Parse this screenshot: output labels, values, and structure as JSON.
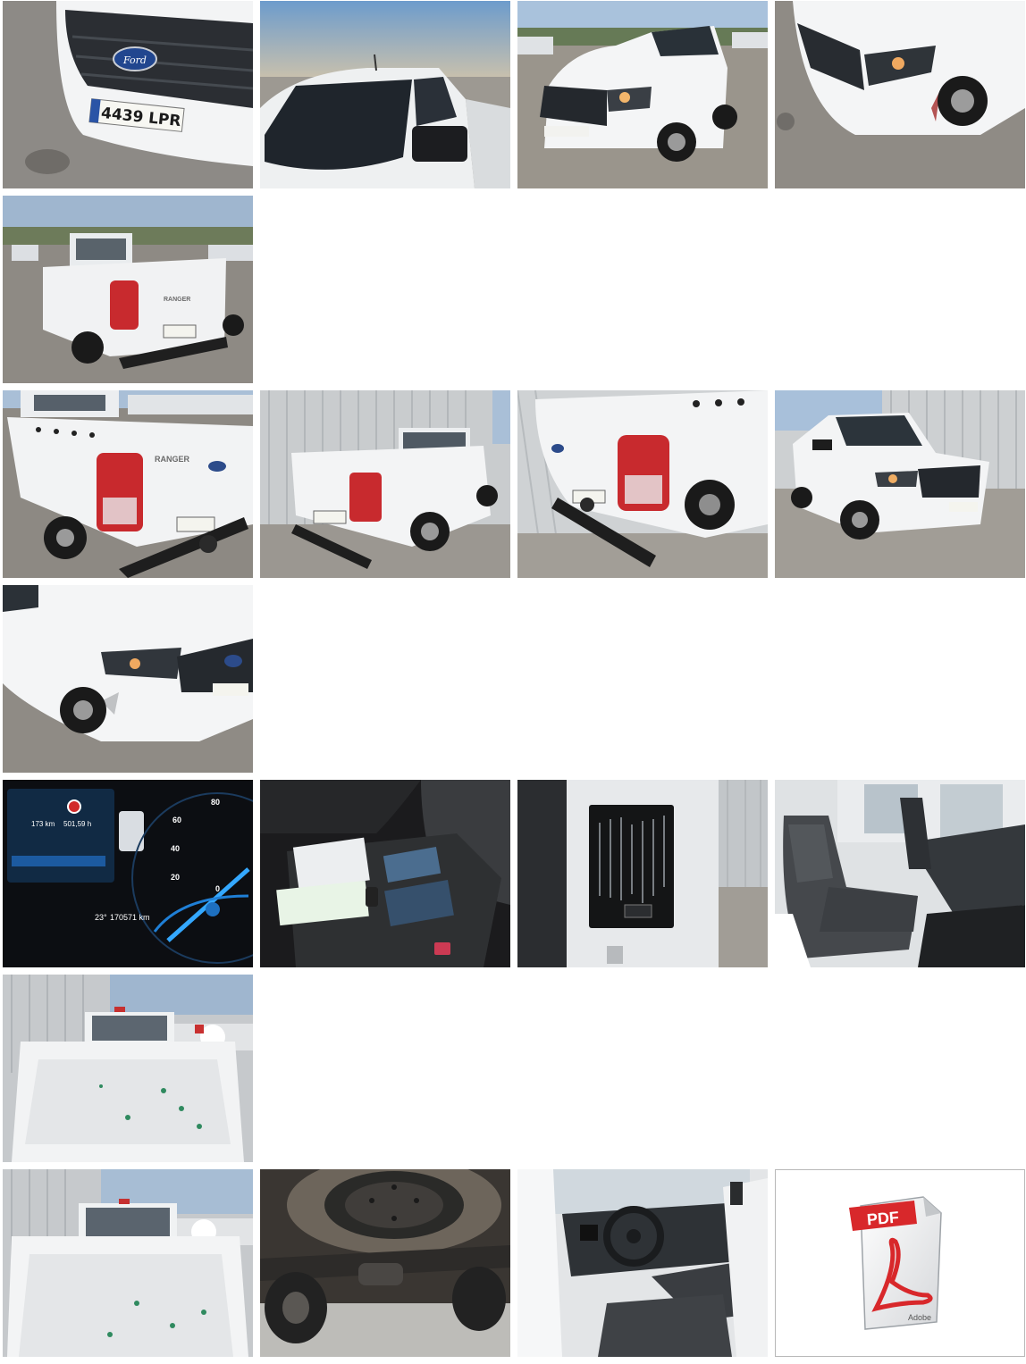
{
  "photos": {
    "plate": "4439 LPR",
    "badge": "RANGER",
    "dash_range": "173 km",
    "dash_trip": "501,59 h",
    "dash_distance": "170571 km",
    "dash_temp": "23°",
    "icon": "camera-photo-icon"
  },
  "pdf": {
    "label": "PDF",
    "brand": "Adobe",
    "icon": "pdf-document-icon"
  },
  "colors": {
    "pdf_red": "#d8282b",
    "truck_white": "#f2f3f4"
  }
}
